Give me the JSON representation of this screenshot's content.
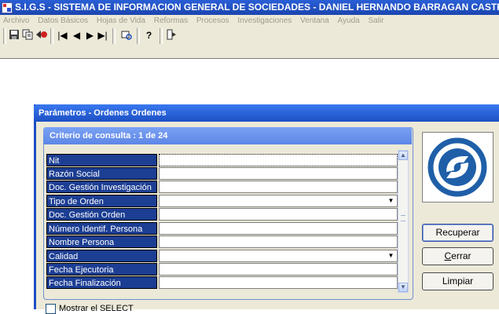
{
  "window": {
    "title": "S.I.G.S  - SISTEMA DE INFORMACION GENERAL DE SOCIEDADES - DANIEL HERNANDO BARRAGAN CASTRO"
  },
  "menu": {
    "items": [
      "Archivo",
      "Datos Básicos",
      "Hojas de Vida",
      "Reformas",
      "Procesos",
      "Investigaciones",
      "Ventana",
      "Ayuda",
      "Salir"
    ]
  },
  "toolbar": {
    "icons": [
      "save-icon",
      "copy-icon",
      "back-icon",
      "first-record-icon",
      "previous-record-icon",
      "next-record-icon",
      "last-record-icon",
      "query-icon",
      "help-icon",
      "exit-icon"
    ]
  },
  "dialog": {
    "title": "Parámetros - Ordenes Ordenes",
    "criteria_header": "Criterio de consulta : 1  de  24",
    "fields": [
      {
        "label": "Nit",
        "value": "",
        "dropdown": false
      },
      {
        "label": "Razón Social",
        "value": "",
        "dropdown": false
      },
      {
        "label": "Doc. Gestión Investigación",
        "value": "",
        "dropdown": false
      },
      {
        "label": "Tipo de Orden",
        "value": "",
        "dropdown": true
      },
      {
        "label": "Doc. Gestión Orden",
        "value": "",
        "dropdown": false
      },
      {
        "label": "Número Identif. Persona",
        "value": "",
        "dropdown": false
      },
      {
        "label": "Nombre Persona",
        "value": "",
        "dropdown": false
      },
      {
        "label": "Calidad",
        "value": "",
        "dropdown": true
      },
      {
        "label": "Fecha Ejecutoria",
        "value": "",
        "dropdown": false
      },
      {
        "label": "Fecha Finalización",
        "value": "",
        "dropdown": false
      }
    ],
    "buttons": {
      "recuperar": "Recuperar",
      "cerrar_first": "C",
      "cerrar_rest": "errar",
      "limpiar": "Limpiar"
    },
    "checkbox_label": "Mostrar el SELECT",
    "logo": "supersociedades-logo"
  },
  "colors": {
    "title_bar": "#1b45b0",
    "label_bg": "#1c3e93",
    "panel_header": "#6a92ea",
    "logo_blue": "#1f5fa8"
  }
}
